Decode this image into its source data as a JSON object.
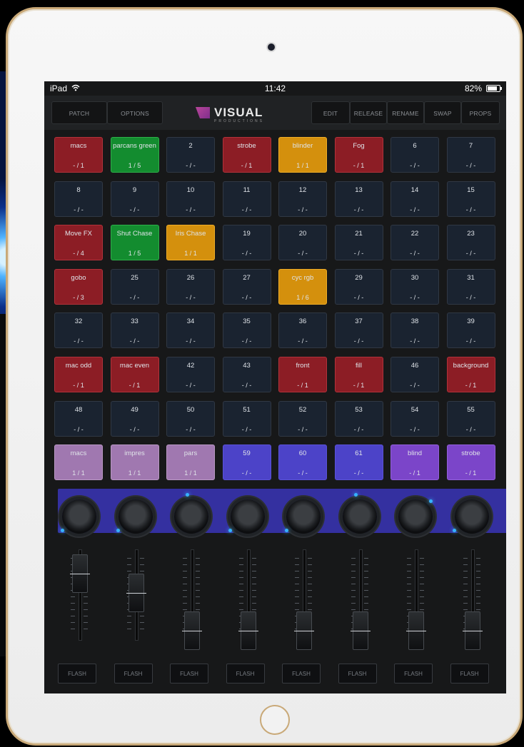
{
  "status": {
    "device": "iPad",
    "time": "11:42",
    "battery": "82%",
    "battery_fraction": 0.82
  },
  "toolbar": {
    "patch": "PATCH",
    "options": "OPTIONS",
    "edit": "EDIT",
    "release": "RELEASE",
    "rename": "RENAME",
    "swap": "SWAP",
    "props": "PROPS",
    "logo_word": "VISUAL",
    "logo_sub": "PRODUCTIONS"
  },
  "grid": [
    [
      {
        "label": "macs",
        "value": "- / 1",
        "state": "red"
      },
      {
        "label": "parcans green",
        "value": "1 / 5",
        "state": "green"
      },
      {
        "label": "2",
        "value": "- / -",
        "state": "empty"
      },
      {
        "label": "strobe",
        "value": "- / 1",
        "state": "red"
      },
      {
        "label": "blinder",
        "value": "1 / 1",
        "state": "amber"
      },
      {
        "label": "Fog",
        "value": "- / 1",
        "state": "red"
      },
      {
        "label": "6",
        "value": "- / -",
        "state": "empty"
      },
      {
        "label": "7",
        "value": "- / -",
        "state": "empty"
      }
    ],
    [
      {
        "label": "8",
        "value": "- / -",
        "state": "empty"
      },
      {
        "label": "9",
        "value": "- / -",
        "state": "empty"
      },
      {
        "label": "10",
        "value": "- / -",
        "state": "empty"
      },
      {
        "label": "11",
        "value": "- / -",
        "state": "empty"
      },
      {
        "label": "12",
        "value": "- / -",
        "state": "empty"
      },
      {
        "label": "13",
        "value": "- / -",
        "state": "empty"
      },
      {
        "label": "14",
        "value": "- / -",
        "state": "empty"
      },
      {
        "label": "15",
        "value": "- / -",
        "state": "empty"
      }
    ],
    [
      {
        "label": "Move FX",
        "value": "- / 4",
        "state": "red"
      },
      {
        "label": "Shut Chase",
        "value": "1 / 5",
        "state": "green"
      },
      {
        "label": "Iris Chase",
        "value": "1 / 1",
        "state": "amber"
      },
      {
        "label": "19",
        "value": "- / -",
        "state": "empty"
      },
      {
        "label": "20",
        "value": "- / -",
        "state": "empty"
      },
      {
        "label": "21",
        "value": "- / -",
        "state": "empty"
      },
      {
        "label": "22",
        "value": "- / -",
        "state": "empty"
      },
      {
        "label": "23",
        "value": "- / -",
        "state": "empty"
      }
    ],
    [
      {
        "label": "gobo",
        "value": "- / 3",
        "state": "red"
      },
      {
        "label": "25",
        "value": "- / -",
        "state": "empty"
      },
      {
        "label": "26",
        "value": "- / -",
        "state": "empty"
      },
      {
        "label": "27",
        "value": "- / -",
        "state": "empty"
      },
      {
        "label": "cyc rgb",
        "value": "1 / 6",
        "state": "amber"
      },
      {
        "label": "29",
        "value": "- / -",
        "state": "empty"
      },
      {
        "label": "30",
        "value": "- / -",
        "state": "empty"
      },
      {
        "label": "31",
        "value": "- / -",
        "state": "empty"
      }
    ],
    [
      {
        "label": "32",
        "value": "- / -",
        "state": "empty"
      },
      {
        "label": "33",
        "value": "- / -",
        "state": "empty"
      },
      {
        "label": "34",
        "value": "- / -",
        "state": "empty"
      },
      {
        "label": "35",
        "value": "- / -",
        "state": "empty"
      },
      {
        "label": "36",
        "value": "- / -",
        "state": "empty"
      },
      {
        "label": "37",
        "value": "- / -",
        "state": "empty"
      },
      {
        "label": "38",
        "value": "- / -",
        "state": "empty"
      },
      {
        "label": "39",
        "value": "- / -",
        "state": "empty"
      }
    ],
    [
      {
        "label": "mac odd",
        "value": "- / 1",
        "state": "red"
      },
      {
        "label": "mac even",
        "value": "- / 1",
        "state": "red"
      },
      {
        "label": "42",
        "value": "- / -",
        "state": "empty"
      },
      {
        "label": "43",
        "value": "- / -",
        "state": "empty"
      },
      {
        "label": "front",
        "value": "- / 1",
        "state": "red"
      },
      {
        "label": "fill",
        "value": "- / 1",
        "state": "red"
      },
      {
        "label": "46",
        "value": "- / -",
        "state": "empty"
      },
      {
        "label": "background",
        "value": "- / 1",
        "state": "red"
      }
    ],
    [
      {
        "label": "48",
        "value": "- / -",
        "state": "empty"
      },
      {
        "label": "49",
        "value": "- / -",
        "state": "empty"
      },
      {
        "label": "50",
        "value": "- / -",
        "state": "empty"
      },
      {
        "label": "51",
        "value": "- / -",
        "state": "empty"
      },
      {
        "label": "52",
        "value": "- / -",
        "state": "empty"
      },
      {
        "label": "53",
        "value": "- / -",
        "state": "empty"
      },
      {
        "label": "54",
        "value": "- / -",
        "state": "empty"
      },
      {
        "label": "55",
        "value": "- / -",
        "state": "empty"
      }
    ],
    [
      {
        "label": "macs",
        "value": "1 / 1",
        "state": "dim"
      },
      {
        "label": "impres",
        "value": "1 / 1",
        "state": "dim"
      },
      {
        "label": "pars",
        "value": "1 / 1",
        "state": "dim"
      },
      {
        "label": "59",
        "value": "- / -",
        "state": "blue"
      },
      {
        "label": "60",
        "value": "- / -",
        "state": "blue"
      },
      {
        "label": "61",
        "value": "- / -",
        "state": "blue"
      },
      {
        "label": "blind",
        "value": "- / 1",
        "state": "purple"
      },
      {
        "label": "strobe",
        "value": "- / 1",
        "state": "purple"
      }
    ]
  ],
  "faders": [
    {
      "flash": "FLASH",
      "level": 0.8,
      "knob_angle": -130
    },
    {
      "flash": "FLASH",
      "level": 0.55,
      "knob_angle": -130
    },
    {
      "flash": "FLASH",
      "level": 0.05,
      "knob_angle": -10
    },
    {
      "flash": "FLASH",
      "level": 0.05,
      "knob_angle": -130
    },
    {
      "flash": "FLASH",
      "level": 0.05,
      "knob_angle": -130
    },
    {
      "flash": "FLASH",
      "level": 0.05,
      "knob_angle": -10
    },
    {
      "flash": "FLASH",
      "level": 0.05,
      "knob_angle": 45
    },
    {
      "flash": "FLASH",
      "level": 0.05,
      "knob_angle": -130
    }
  ],
  "colors": {
    "red": "#8c1d25",
    "green": "#138c2f",
    "amber": "#d4900d",
    "purple": "#7b45c9",
    "selection": "#3a35b9",
    "knob_led": "#37b2ff"
  }
}
